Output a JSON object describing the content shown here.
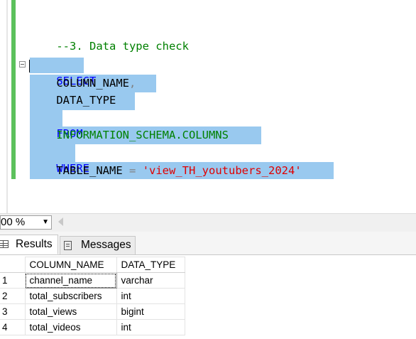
{
  "editor": {
    "comment": "--3. Data type check",
    "kw_select": "SELECT",
    "col1": "COLUMN_NAME",
    "comma": ",",
    "col2": "DATA_TYPE",
    "kw_from": "FROM",
    "source": "INFORMATION_SCHEMA.COLUMNS",
    "kw_where": "WHERE",
    "where_col": "TABLE_NAME",
    "equals": "=",
    "where_val": "'view_TH_youtubers_2024'"
  },
  "status": {
    "zoom": "00 %"
  },
  "tabs": {
    "results": "Results",
    "messages": "Messages"
  },
  "results": {
    "columns": [
      "COLUMN_NAME",
      "DATA_TYPE"
    ],
    "rows": [
      {
        "num": "1",
        "column_name": "channel_name",
        "data_type": "varchar"
      },
      {
        "num": "2",
        "column_name": "total_subscribers",
        "data_type": "int"
      },
      {
        "num": "3",
        "column_name": "total_views",
        "data_type": "bigint"
      },
      {
        "num": "4",
        "column_name": "total_videos",
        "data_type": "int"
      }
    ]
  }
}
